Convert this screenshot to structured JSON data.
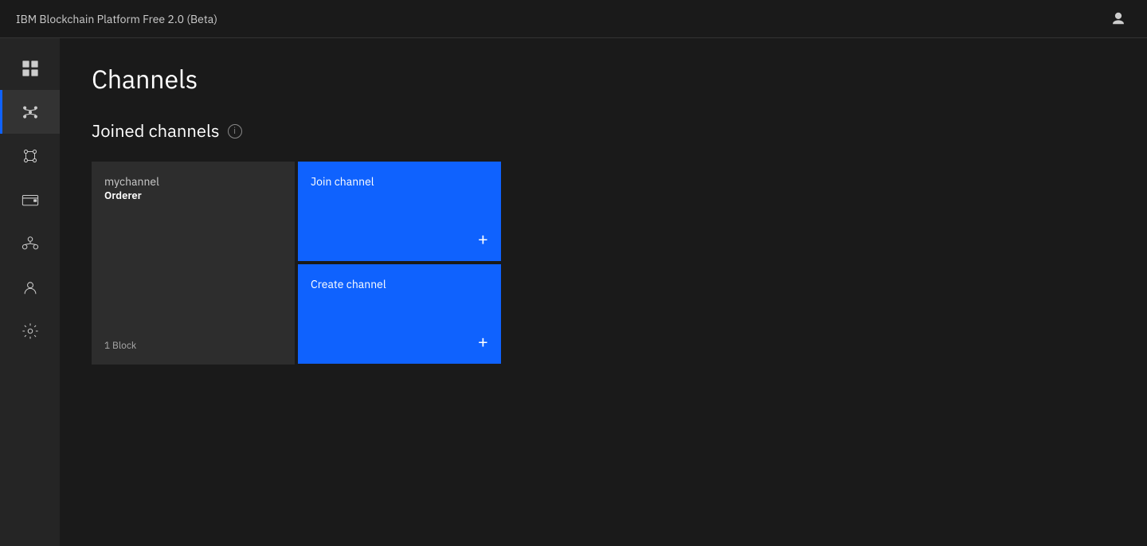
{
  "topbar": {
    "title": "IBM Blockchain Platform Free 2.0 (Beta)",
    "user_icon": "person-icon"
  },
  "sidebar": {
    "items": [
      {
        "id": "dashboard",
        "icon": "grid-icon",
        "active": false
      },
      {
        "id": "channels",
        "icon": "network-icon",
        "active": true
      },
      {
        "id": "nodes",
        "icon": "nodes-icon",
        "active": false
      },
      {
        "id": "wallet",
        "icon": "wallet-icon",
        "active": false
      },
      {
        "id": "organizations",
        "icon": "organizations-icon",
        "active": false
      },
      {
        "id": "identity",
        "icon": "identity-icon",
        "active": false
      },
      {
        "id": "settings",
        "icon": "settings-icon",
        "active": false
      }
    ]
  },
  "page": {
    "title": "Channels",
    "section_title": "Joined channels",
    "info_tooltip": "Information about joined channels"
  },
  "channel_card": {
    "name": "mychannel",
    "orderer_label": "Orderer",
    "block_count": "1 Block"
  },
  "action_cards": [
    {
      "id": "join-channel",
      "label": "Join channel",
      "plus": "+"
    },
    {
      "id": "create-channel",
      "label": "Create channel",
      "plus": "+"
    }
  ]
}
